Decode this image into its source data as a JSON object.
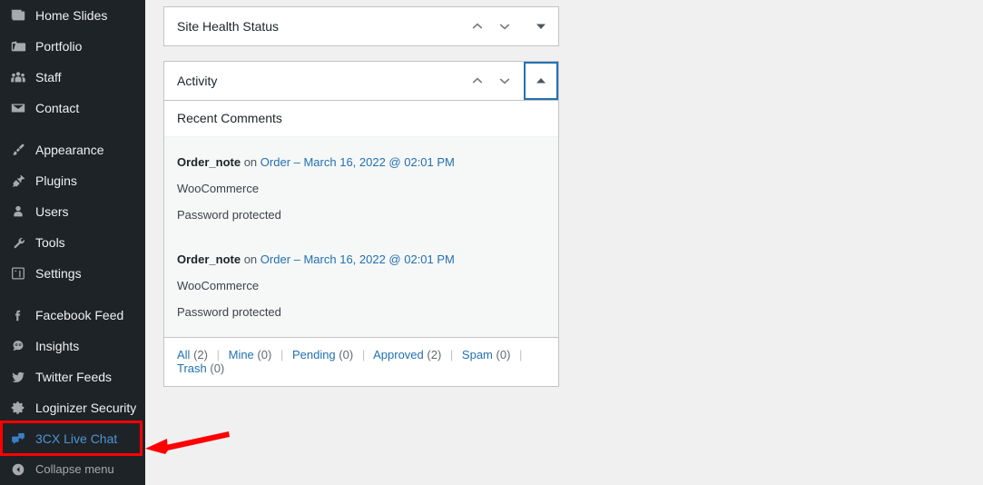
{
  "sidebar": {
    "groups": [
      {
        "items": [
          {
            "label": "Home Slides",
            "icon": "images-stack-icon",
            "name": "sidebar-item-home-slides"
          },
          {
            "label": "Portfolio",
            "icon": "portfolio-icon",
            "name": "sidebar-item-portfolio"
          },
          {
            "label": "Staff",
            "icon": "group-icon",
            "name": "sidebar-item-staff"
          },
          {
            "label": "Contact",
            "icon": "envelope-icon",
            "name": "sidebar-item-contact"
          }
        ]
      },
      {
        "items": [
          {
            "label": "Appearance",
            "icon": "paintbrush-icon",
            "name": "sidebar-item-appearance"
          },
          {
            "label": "Plugins",
            "icon": "plug-icon",
            "name": "sidebar-item-plugins"
          },
          {
            "label": "Users",
            "icon": "user-icon",
            "name": "sidebar-item-users"
          },
          {
            "label": "Tools",
            "icon": "wrench-icon",
            "name": "sidebar-item-tools"
          },
          {
            "label": "Settings",
            "icon": "sliders-icon",
            "name": "sidebar-item-settings"
          }
        ]
      },
      {
        "items": [
          {
            "label": "Facebook Feed",
            "icon": "facebook-icon",
            "name": "sidebar-item-facebook-feed"
          },
          {
            "label": "Insights",
            "icon": "insights-icon",
            "name": "sidebar-item-insights"
          },
          {
            "label": "Twitter Feeds",
            "icon": "twitter-icon",
            "name": "sidebar-item-twitter-feeds"
          },
          {
            "label": "Loginizer Security",
            "icon": "gear-icon",
            "name": "sidebar-item-loginizer-security"
          },
          {
            "label": "3CX Live Chat",
            "icon": "chat-bubbles-icon",
            "name": "sidebar-item-3cx-live-chat",
            "highlighted": true
          }
        ]
      }
    ],
    "collapse": {
      "label": "Collapse menu",
      "icon": "collapse-arrow-icon"
    }
  },
  "annotation": {
    "highlight_color": "#ff0000",
    "arrow_color": "#ff0000",
    "target": "3CX Live Chat"
  },
  "panels": {
    "site_health": {
      "title": "Site Health Status",
      "move_up_label": "Move up",
      "move_down_label": "Move down",
      "toggle_state": "collapsed"
    },
    "activity": {
      "title": "Activity",
      "move_up_label": "Move up",
      "move_down_label": "Move down",
      "toggle_state": "expanded",
      "section_title": "Recent Comments",
      "comments": [
        {
          "author": "Order_note",
          "on_text": "on",
          "post_link": "Order – March 16, 2022 @ 02:01 PM",
          "excerpt": "WooCommerce",
          "status": "Password protected"
        },
        {
          "author": "Order_note",
          "on_text": "on",
          "post_link": "Order – March 16, 2022 @ 02:01 PM",
          "excerpt": "WooCommerce",
          "status": "Password protected"
        }
      ],
      "filters": [
        {
          "label": "All",
          "count": "(2)"
        },
        {
          "label": "Mine",
          "count": "(0)"
        },
        {
          "label": "Pending",
          "count": "(0)"
        },
        {
          "label": "Approved",
          "count": "(2)"
        },
        {
          "label": "Spam",
          "count": "(0)"
        },
        {
          "label": "Trash",
          "count": "(0)"
        }
      ]
    }
  },
  "colors": {
    "sidebar_bg": "#1d2327",
    "page_bg": "#f0f0f1",
    "link": "#2271b1",
    "highlight_text": "#4f94d4",
    "annotation": "#ff0000"
  }
}
